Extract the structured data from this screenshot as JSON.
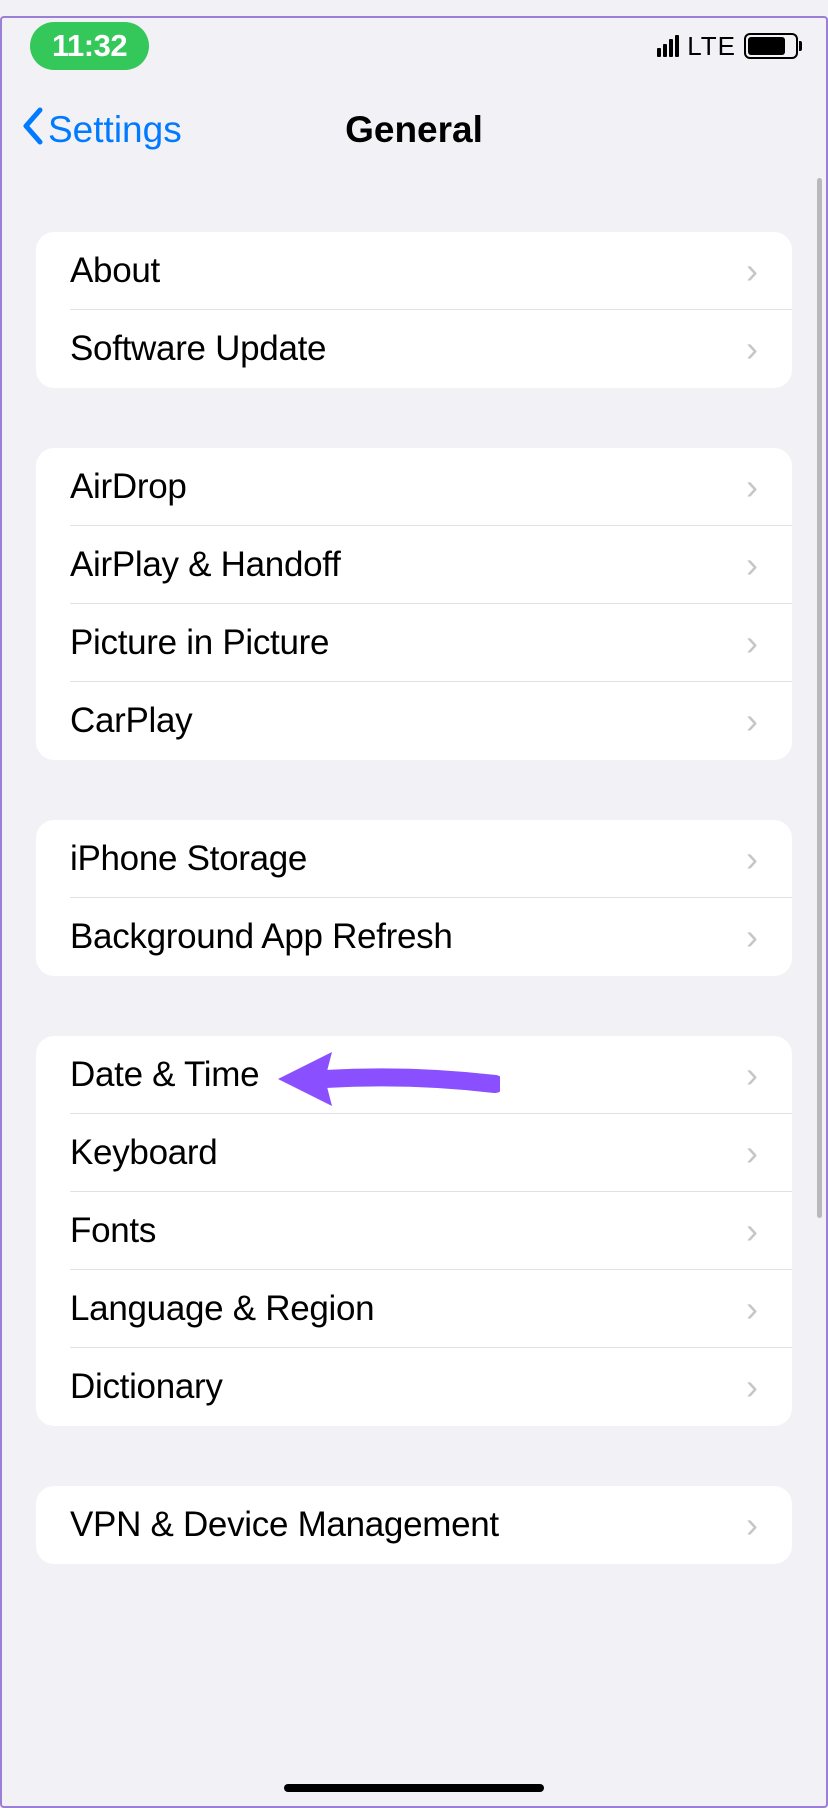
{
  "status": {
    "time": "11:32",
    "network": "LTE"
  },
  "nav": {
    "back_label": "Settings",
    "title": "General"
  },
  "groups": [
    {
      "rows": [
        "About",
        "Software Update"
      ]
    },
    {
      "rows": [
        "AirDrop",
        "AirPlay & Handoff",
        "Picture in Picture",
        "CarPlay"
      ]
    },
    {
      "rows": [
        "iPhone Storage",
        "Background App Refresh"
      ]
    },
    {
      "rows": [
        "Date & Time",
        "Keyboard",
        "Fonts",
        "Language & Region",
        "Dictionary"
      ]
    },
    {
      "rows": [
        "VPN & Device Management"
      ]
    }
  ],
  "annotation": {
    "target_row": "Date & Time",
    "color": "#8a4fff"
  }
}
